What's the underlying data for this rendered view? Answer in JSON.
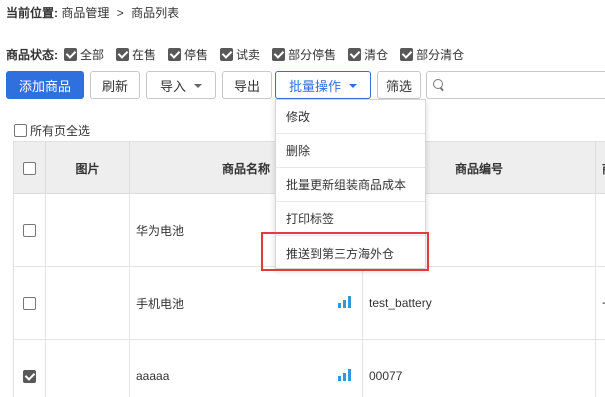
{
  "breadcrumb": {
    "prefix": "当前位置:",
    "items": [
      "商品管理",
      "商品列表"
    ],
    "separator": ">"
  },
  "status_filter": {
    "label": "商品状态:",
    "options": [
      {
        "label": "全部",
        "checked": true
      },
      {
        "label": "在售",
        "checked": true
      },
      {
        "label": "停售",
        "checked": true
      },
      {
        "label": "试卖",
        "checked": true
      },
      {
        "label": "部分停售",
        "checked": true
      },
      {
        "label": "清仓",
        "checked": true
      },
      {
        "label": "部分清仓",
        "checked": true
      }
    ]
  },
  "toolbar": {
    "add_label": "添加商品",
    "refresh_label": "刷新",
    "import_label": "导入",
    "export_label": "导出",
    "batch_label": "批量操作",
    "filter_label": "筛选",
    "search_value": "",
    "search_icon": "search-icon"
  },
  "select_all_pages": {
    "label": "所有页全选",
    "checked": false
  },
  "table": {
    "headers": {
      "image": "图片",
      "name": "商品名称",
      "code": "商品编号",
      "extra": "商"
    },
    "rows": [
      {
        "checked": false,
        "name": "华为电池",
        "code": "",
        "extra": "",
        "has_stats_icon": false
      },
      {
        "checked": false,
        "name": "手机电池",
        "code": "test_battery",
        "extra": "七彩",
        "has_stats_icon": true
      },
      {
        "checked": true,
        "name": "aaaaa",
        "code": "00077",
        "extra": "",
        "has_stats_icon": true
      }
    ]
  },
  "batch_menu": {
    "items": [
      "修改",
      "删除",
      "批量更新组装商品成本",
      "打印标签",
      "推送到第三方海外仓"
    ]
  },
  "colors": {
    "primary": "#2f6fde",
    "highlight": "#e33b3b",
    "stats_icon": "#2f9ad6"
  }
}
